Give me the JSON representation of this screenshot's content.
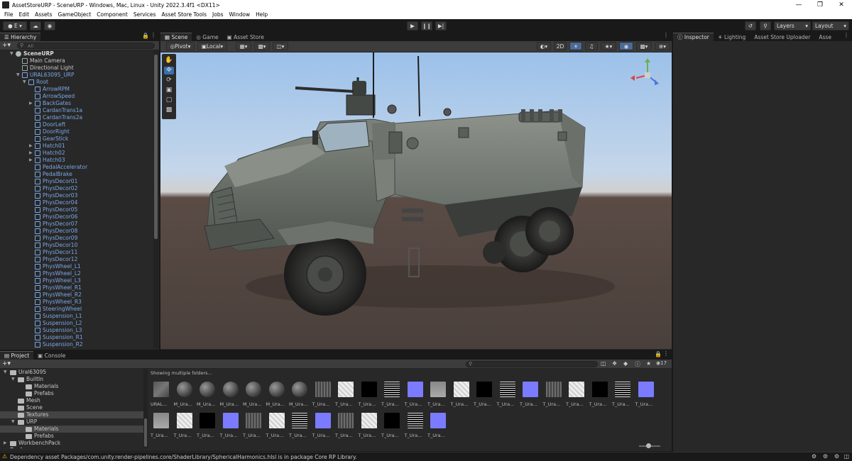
{
  "window": {
    "title": "AssetStoreURP - SceneURP - Windows, Mac, Linux - Unity 2022.3.4f1 <DX11>"
  },
  "menu": [
    "File",
    "Edit",
    "Assets",
    "GameObject",
    "Component",
    "Services",
    "Asset Store Tools",
    "Jobs",
    "Window",
    "Help"
  ],
  "toolbar": {
    "account_label": "E",
    "layers_label": "Layers",
    "layout_label": "Layout"
  },
  "hierarchy": {
    "tab": "Hierarchy",
    "search_placeholder": "All",
    "rows": [
      {
        "label": "SceneURP",
        "depth": 0,
        "arrow": "open",
        "type": "scene"
      },
      {
        "label": "Main Camera",
        "depth": 1,
        "arrow": "",
        "type": "obj"
      },
      {
        "label": "Directional Light",
        "depth": 1,
        "arrow": "",
        "type": "obj"
      },
      {
        "label": "URAL63095_URP",
        "depth": 1,
        "arrow": "open",
        "type": "prefab"
      },
      {
        "label": "Root",
        "depth": 2,
        "arrow": "open",
        "type": "prefab"
      },
      {
        "label": "ArrowRPM",
        "depth": 3,
        "arrow": "",
        "type": "prefab"
      },
      {
        "label": "ArrowSpeed",
        "depth": 3,
        "arrow": "",
        "type": "prefab"
      },
      {
        "label": "BackGates",
        "depth": 3,
        "arrow": "closed",
        "type": "prefab"
      },
      {
        "label": "CardanTrans1a",
        "depth": 3,
        "arrow": "",
        "type": "prefab"
      },
      {
        "label": "CardanTrans2a",
        "depth": 3,
        "arrow": "",
        "type": "prefab"
      },
      {
        "label": "DoorLeft",
        "depth": 3,
        "arrow": "",
        "type": "prefab"
      },
      {
        "label": "DoorRight",
        "depth": 3,
        "arrow": "",
        "type": "prefab"
      },
      {
        "label": "GearStick",
        "depth": 3,
        "arrow": "",
        "type": "prefab"
      },
      {
        "label": "Hatch01",
        "depth": 3,
        "arrow": "closed",
        "type": "prefab"
      },
      {
        "label": "Hatch02",
        "depth": 3,
        "arrow": "closed",
        "type": "prefab"
      },
      {
        "label": "Hatch03",
        "depth": 3,
        "arrow": "closed",
        "type": "prefab"
      },
      {
        "label": "PedalAccelerator",
        "depth": 3,
        "arrow": "",
        "type": "prefab"
      },
      {
        "label": "PedalBrake",
        "depth": 3,
        "arrow": "",
        "type": "prefab"
      },
      {
        "label": "PhysDecor01",
        "depth": 3,
        "arrow": "",
        "type": "prefab"
      },
      {
        "label": "PhysDecor02",
        "depth": 3,
        "arrow": "",
        "type": "prefab"
      },
      {
        "label": "PhysDecor03",
        "depth": 3,
        "arrow": "",
        "type": "prefab"
      },
      {
        "label": "PhysDecor04",
        "depth": 3,
        "arrow": "",
        "type": "prefab"
      },
      {
        "label": "PhysDecor05",
        "depth": 3,
        "arrow": "",
        "type": "prefab"
      },
      {
        "label": "PhysDecor06",
        "depth": 3,
        "arrow": "",
        "type": "prefab"
      },
      {
        "label": "PhysDecor07",
        "depth": 3,
        "arrow": "",
        "type": "prefab"
      },
      {
        "label": "PhysDecor08",
        "depth": 3,
        "arrow": "",
        "type": "prefab"
      },
      {
        "label": "PhysDecor09",
        "depth": 3,
        "arrow": "",
        "type": "prefab"
      },
      {
        "label": "PhysDecor10",
        "depth": 3,
        "arrow": "",
        "type": "prefab"
      },
      {
        "label": "PhysDecor11",
        "depth": 3,
        "arrow": "",
        "type": "prefab"
      },
      {
        "label": "PhysDecor12",
        "depth": 3,
        "arrow": "",
        "type": "prefab"
      },
      {
        "label": "PhysWheel_L1",
        "depth": 3,
        "arrow": "",
        "type": "prefab"
      },
      {
        "label": "PhysWheel_L2",
        "depth": 3,
        "arrow": "",
        "type": "prefab"
      },
      {
        "label": "PhysWheel_L3",
        "depth": 3,
        "arrow": "",
        "type": "prefab"
      },
      {
        "label": "PhysWheel_R1",
        "depth": 3,
        "arrow": "",
        "type": "prefab"
      },
      {
        "label": "PhysWheel_R2",
        "depth": 3,
        "arrow": "",
        "type": "prefab"
      },
      {
        "label": "PhysWheel_R3",
        "depth": 3,
        "arrow": "",
        "type": "prefab"
      },
      {
        "label": "SteeringWheel",
        "depth": 3,
        "arrow": "",
        "type": "prefab"
      },
      {
        "label": "Suspension_L1",
        "depth": 3,
        "arrow": "",
        "type": "prefab"
      },
      {
        "label": "Suspension_L2",
        "depth": 3,
        "arrow": "",
        "type": "prefab"
      },
      {
        "label": "Suspension_L3",
        "depth": 3,
        "arrow": "",
        "type": "prefab"
      },
      {
        "label": "Suspension_R1",
        "depth": 3,
        "arrow": "",
        "type": "prefab"
      },
      {
        "label": "Suspension_R2",
        "depth": 3,
        "arrow": "",
        "type": "prefab"
      }
    ]
  },
  "scene": {
    "tabs": [
      "Scene",
      "Game",
      "Asset Store"
    ],
    "pivot_label": "Pivot",
    "local_label": "Local",
    "mode_2d": "2D"
  },
  "inspector": {
    "tabs": [
      "Inspector",
      "Lighting",
      "Asset Store Uploader",
      "Asse"
    ]
  },
  "project": {
    "tabs": [
      "Project",
      "Console"
    ],
    "tree": [
      {
        "label": "Ural63095",
        "depth": 0,
        "arrow": "open"
      },
      {
        "label": "BuiltIn",
        "depth": 1,
        "arrow": "open"
      },
      {
        "label": "Materials",
        "depth": 2,
        "arrow": ""
      },
      {
        "label": "Prefabs",
        "depth": 2,
        "arrow": ""
      },
      {
        "label": "Mesh",
        "depth": 1,
        "arrow": ""
      },
      {
        "label": "Scene",
        "depth": 1,
        "arrow": ""
      },
      {
        "label": "Textures",
        "depth": 1,
        "arrow": "",
        "selected": true
      },
      {
        "label": "URP",
        "depth": 1,
        "arrow": "open"
      },
      {
        "label": "Materials",
        "depth": 2,
        "arrow": "",
        "selected": true
      },
      {
        "label": "Prefabs",
        "depth": 2,
        "arrow": ""
      },
      {
        "label": "WorkbenchPack",
        "depth": 0,
        "arrow": "closed"
      },
      {
        "label": "Packages",
        "depth": -1,
        "arrow": "closed"
      }
    ],
    "breadcrumb": "Showing multiple folders...",
    "hidden_count": "17",
    "assets_row1": [
      {
        "cap": "URAL...",
        "kind": "mesh"
      },
      {
        "cap": "M_Ura...",
        "kind": "sphere"
      },
      {
        "cap": "M_Ura...",
        "kind": "sphere"
      },
      {
        "cap": "M_Ura...",
        "kind": "sphere"
      },
      {
        "cap": "M_Ura...",
        "kind": "sphere"
      },
      {
        "cap": "M_Ura...",
        "kind": "sphere"
      },
      {
        "cap": "M_Ura...",
        "kind": "sphere"
      },
      {
        "cap": "T_Ura...",
        "kind": "grunge"
      },
      {
        "cap": "T_Ura...",
        "kind": "white"
      },
      {
        "cap": "T_Ura...",
        "kind": "black"
      },
      {
        "cap": "T_Ura...",
        "kind": "noise"
      },
      {
        "cap": "T_Ura...",
        "kind": "normal"
      },
      {
        "cap": "T_Ura...",
        "kind": "gray"
      },
      {
        "cap": "T_Ura...",
        "kind": "white"
      },
      {
        "cap": "T_Ura...",
        "kind": "black"
      },
      {
        "cap": "T_Ura...",
        "kind": "noise"
      },
      {
        "cap": "T_Ura...",
        "kind": "normal"
      },
      {
        "cap": "T_Ura...",
        "kind": "grunge"
      },
      {
        "cap": "T_Ura...",
        "kind": "white"
      },
      {
        "cap": "T_Ura...",
        "kind": "black"
      },
      {
        "cap": "T_Ura...",
        "kind": "noise"
      },
      {
        "cap": "T_Ura...",
        "kind": "normal"
      }
    ],
    "assets_row2": [
      {
        "cap": "T_Ura...",
        "kind": "gray"
      },
      {
        "cap": "T_Ura...",
        "kind": "white"
      },
      {
        "cap": "T_Ura...",
        "kind": "black"
      },
      {
        "cap": "T_Ura...",
        "kind": "normal"
      },
      {
        "cap": "T_Ura...",
        "kind": "grunge"
      },
      {
        "cap": "T_Ura...",
        "kind": "white"
      },
      {
        "cap": "T_Ura...",
        "kind": "noise"
      },
      {
        "cap": "T_Ura...",
        "kind": "normal"
      },
      {
        "cap": "T_Ura...",
        "kind": "grunge"
      },
      {
        "cap": "T_Ura...",
        "kind": "white"
      },
      {
        "cap": "T_Ura...",
        "kind": "black"
      },
      {
        "cap": "T_Ura...",
        "kind": "noise"
      },
      {
        "cap": "T_Ura...",
        "kind": "normal"
      }
    ]
  },
  "status": {
    "message": "Dependency asset Packages/com.unity.render-pipelines.core/ShaderLibrary/SphericalHarmonics.hlsl is in package Core RP Library."
  },
  "colors": {
    "accent": "#3a6fb0",
    "prefab_text": "#7aa7e6",
    "warning": "#f0c000"
  }
}
